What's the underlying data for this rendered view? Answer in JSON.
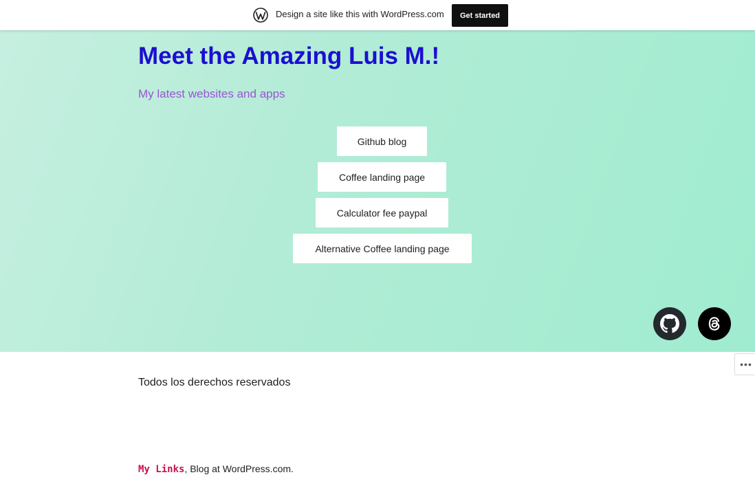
{
  "banner": {
    "text": "Design a site like this with WordPress.com",
    "cta_label": "Get started",
    "logo_icon": "wordpress-logo-icon"
  },
  "hero": {
    "title": "Meet the Amazing Luis M.!",
    "tagline": "My latest websites and apps",
    "links": [
      {
        "label": "Github blog"
      },
      {
        "label": "Coffee landing page"
      },
      {
        "label": "Calculator fee paypal"
      },
      {
        "label": "Alternative Coffee landing page"
      }
    ],
    "social": [
      {
        "icon": "github-icon"
      },
      {
        "icon": "threads-icon"
      }
    ]
  },
  "footer": {
    "more_icon": "ellipsis-icon",
    "copyright": "Todos los derechos reservados",
    "site_link": "My Links",
    "separator": ", ",
    "blog_credit": "Blog at WordPress.com."
  },
  "colors": {
    "title": "#1b0fd0",
    "tagline": "#9d52d6",
    "hero_bg": "#a0ecd0",
    "site_link": "#c8114b"
  }
}
